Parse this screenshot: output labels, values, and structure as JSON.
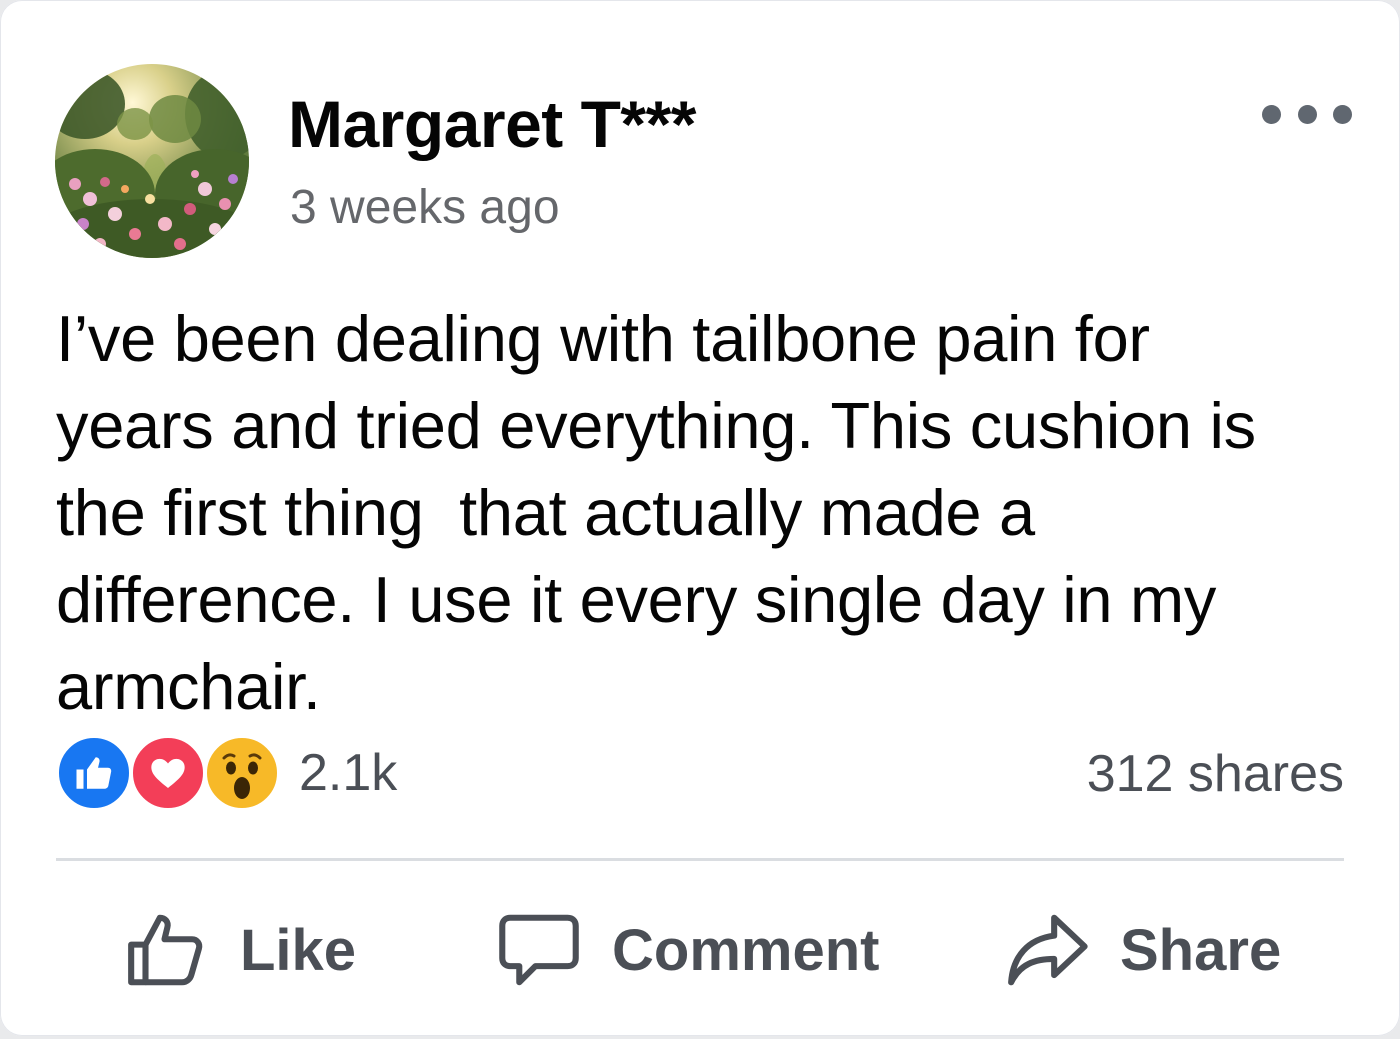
{
  "post": {
    "author": "Margaret T***",
    "timestamp": "3 weeks ago",
    "body": "I’ve been dealing with tailbone pain for\nyears and tried everything. This cushion is\nthe first thing  that actually made a\ndifference. I use it every single day in my\narmchair.",
    "avatar_icon": "garden-photo-avatar",
    "more_icon": "more-options-icon"
  },
  "engagement": {
    "reactions": [
      "like-reaction-icon",
      "love-reaction-icon",
      "wow-reaction-icon"
    ],
    "reaction_count": "2.1k",
    "shares": "312 shares"
  },
  "actions": {
    "like_label": "Like",
    "comment_label": "Comment",
    "share_label": "Share"
  },
  "colors": {
    "like_blue": "#1877f2",
    "love_red": "#f33e58",
    "wow_yellow": "#f7b928",
    "text_primary": "#050505",
    "text_secondary": "#65676b"
  }
}
